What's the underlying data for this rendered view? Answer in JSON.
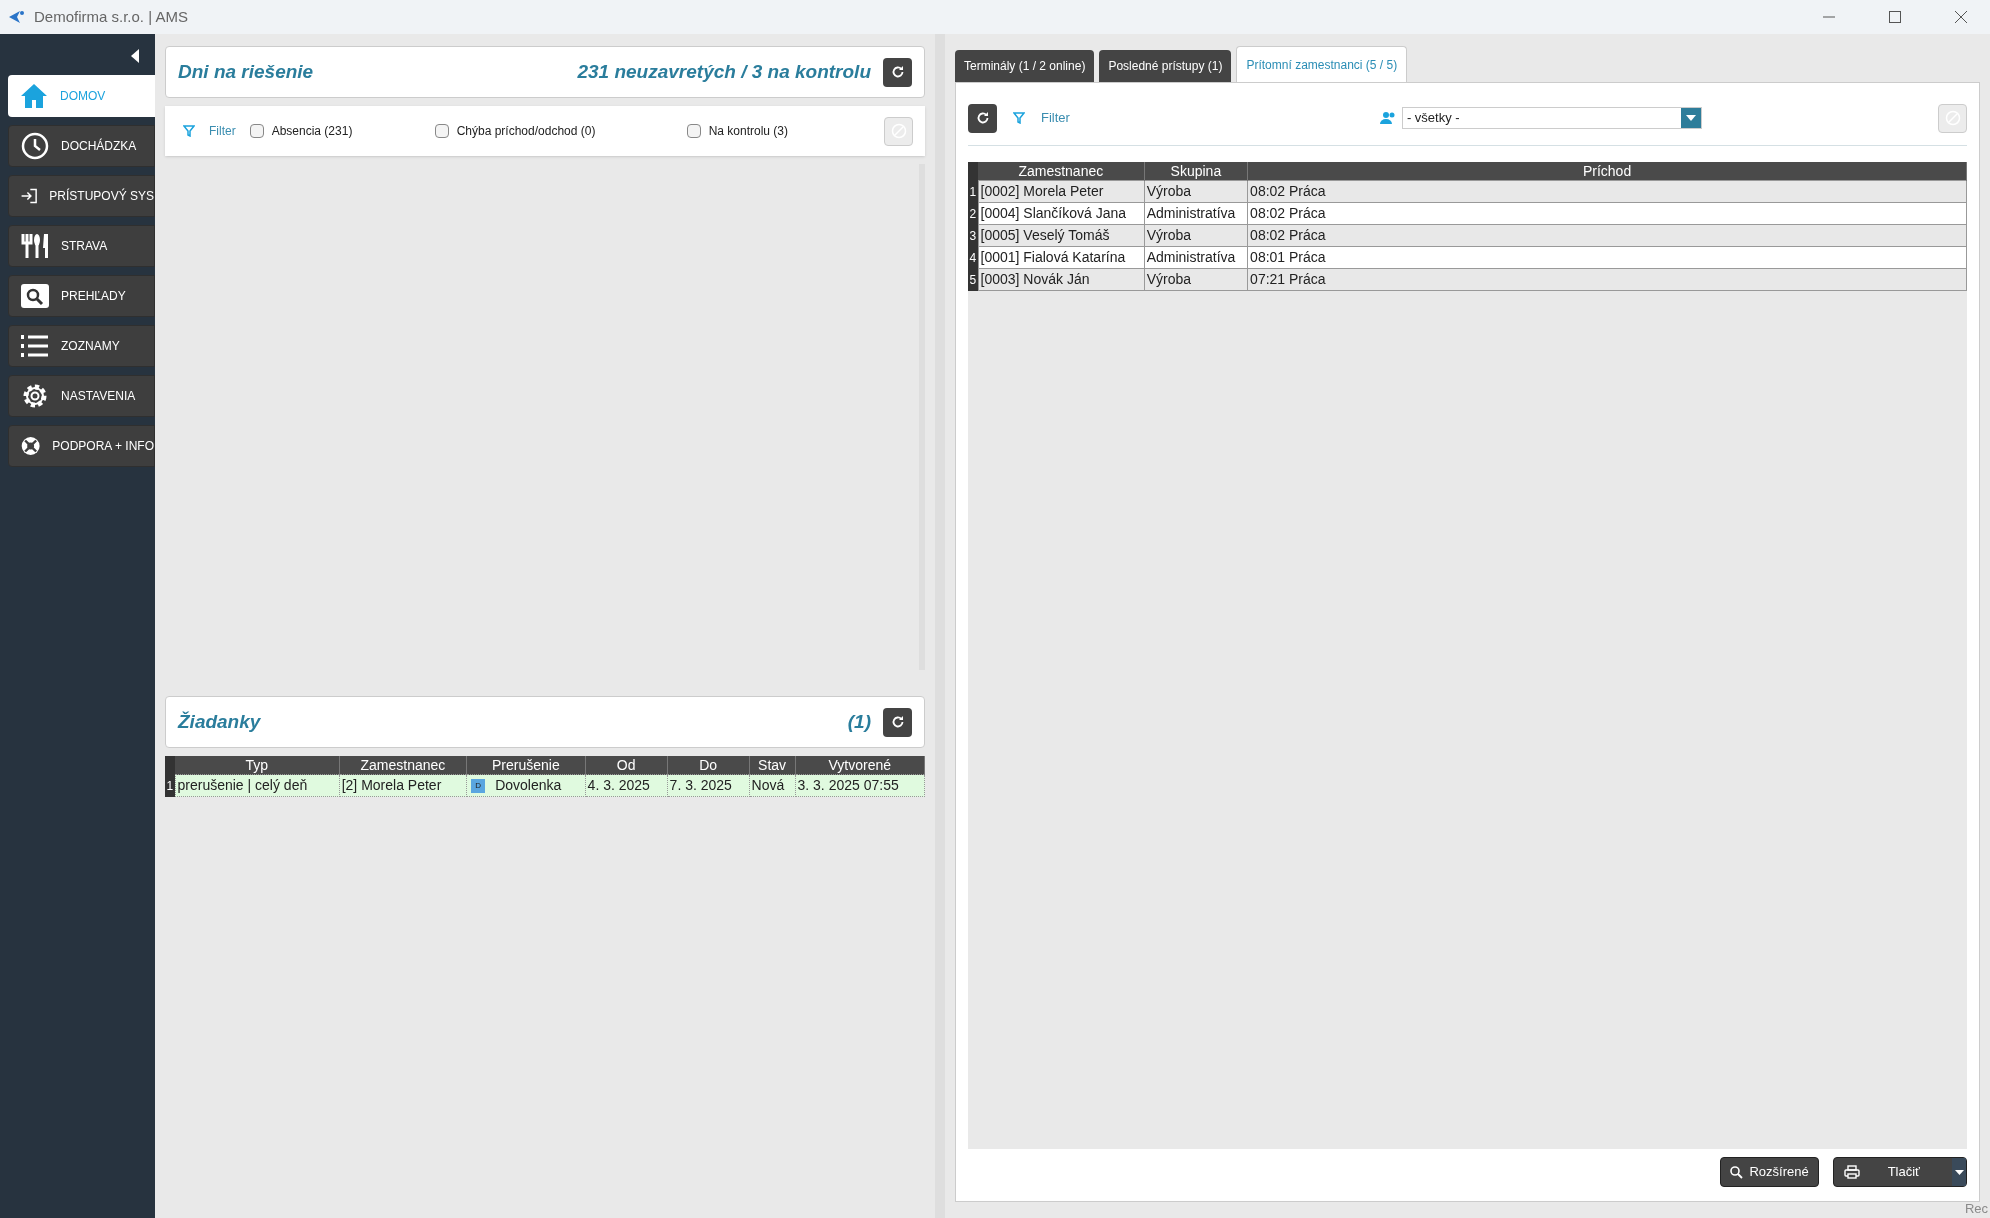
{
  "window": {
    "title": "Demofirma s.r.o. | AMS"
  },
  "sidebar": {
    "items": [
      {
        "label": "DOMOV",
        "selected": true
      },
      {
        "label": "DOCHÁDZKA",
        "selected": false
      },
      {
        "label": "PRÍSTUPOVÝ SYS",
        "selected": false
      },
      {
        "label": "STRAVA",
        "selected": false
      },
      {
        "label": "PREHĽADY",
        "selected": false
      },
      {
        "label": "ZOZNAMY",
        "selected": false
      },
      {
        "label": "NASTAVENIA",
        "selected": false
      },
      {
        "label": "PODPORA + INFO",
        "selected": false
      }
    ]
  },
  "days_panel": {
    "title": "Dni na riešenie",
    "summary": "231 neuzavretých / 3 na kontrolu",
    "filter_label": "Filter",
    "checkboxes": [
      {
        "label": "Absencia (231)",
        "checked": false
      },
      {
        "label": "Chýba príchod/odchod (0)",
        "checked": false
      },
      {
        "label": "Na kontrolu (3)",
        "checked": false
      }
    ]
  },
  "requests_panel": {
    "title": "Žiadanky",
    "count": "(1)",
    "columns": [
      "Typ",
      "Zamestnanec",
      "Prerušenie",
      "Od",
      "Do",
      "Stav",
      "Vytvorené"
    ],
    "rows": [
      {
        "number": "1",
        "cells": [
          "prerušenie | celý deň",
          "[2] Morela Peter",
          "Dovolenka",
          "4. 3. 2025",
          "7. 3. 2025",
          "Nová",
          "3. 3. 2025  07:55"
        ],
        "badge": "D"
      }
    ]
  },
  "tabs": [
    {
      "label": "Terminály (1 / 2 online)",
      "selected": false
    },
    {
      "label": "Posledné prístupy (1)",
      "selected": false
    },
    {
      "label": "Prítomní zamestnanci (5 / 5)",
      "selected": true
    }
  ],
  "present_panel": {
    "filter_label": "Filter",
    "group_select": "- všetky -",
    "columns": [
      "Zamestnanec",
      "Skupina",
      "Príchod"
    ],
    "rows": [
      {
        "number": "1",
        "cells": [
          "[0002] Morela Peter",
          "Výroba",
          "08:02 Práca"
        ]
      },
      {
        "number": "2",
        "cells": [
          "[0004] Slančíková Jana",
          "Administratíva",
          "08:02 Práca"
        ]
      },
      {
        "number": "3",
        "cells": [
          "[0005] Veselý Tomáš",
          "Výroba",
          "08:02 Práca"
        ]
      },
      {
        "number": "4",
        "cells": [
          "[0001] Fialová Katarína",
          "Administratíva",
          "08:01 Práca"
        ]
      },
      {
        "number": "5",
        "cells": [
          "[0003] Novák Ján",
          "Výroba",
          "07:21 Práca"
        ]
      }
    ],
    "buttons": [
      {
        "label": "Rozšírené",
        "kind": "search"
      },
      {
        "label": "Tlačiť",
        "kind": "print"
      }
    ]
  },
  "corner_text": "Rec"
}
